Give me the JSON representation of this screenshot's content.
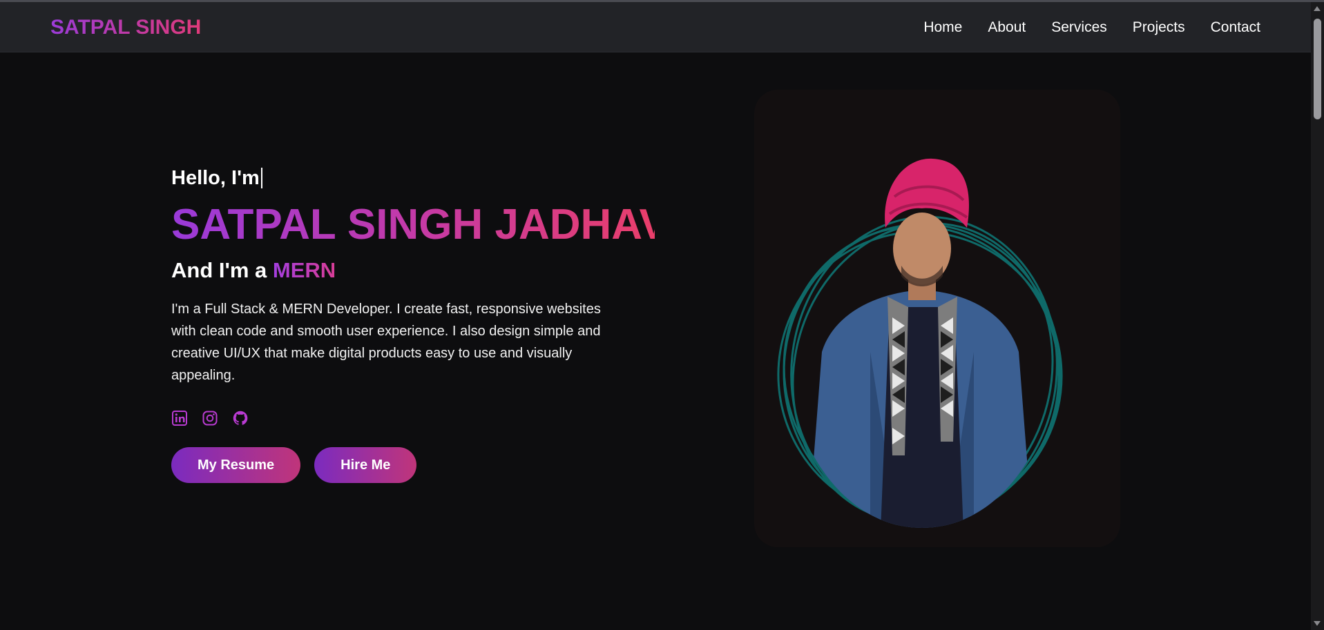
{
  "nav": {
    "logo": "SATPAL SINGH",
    "links": [
      "Home",
      "About",
      "Services",
      "Projects",
      "Contact"
    ]
  },
  "hero": {
    "greeting": "Hello, I'm",
    "name": "SATPAL SINGH JADHAV",
    "role_prefix": "And I'm a ",
    "role_word": "MERN",
    "description": "I'm a Full Stack & MERN Developer. I create fast, responsive websites with clean code and smooth user experience. I also design simple and creative UI/UX that make digital products easy to use and visually appealing.",
    "social_icons": [
      "linkedin-icon",
      "instagram-icon",
      "github-icon"
    ],
    "resume_button": "My Resume",
    "hire_button": "Hire Me"
  },
  "colors": {
    "background": "#0d0d0f",
    "navbar": "#222327",
    "accent_start": "#9b3bd8",
    "accent_end": "#e03a79",
    "icon": "#b93bd2",
    "portrait_ring": "#0f6f6e"
  }
}
